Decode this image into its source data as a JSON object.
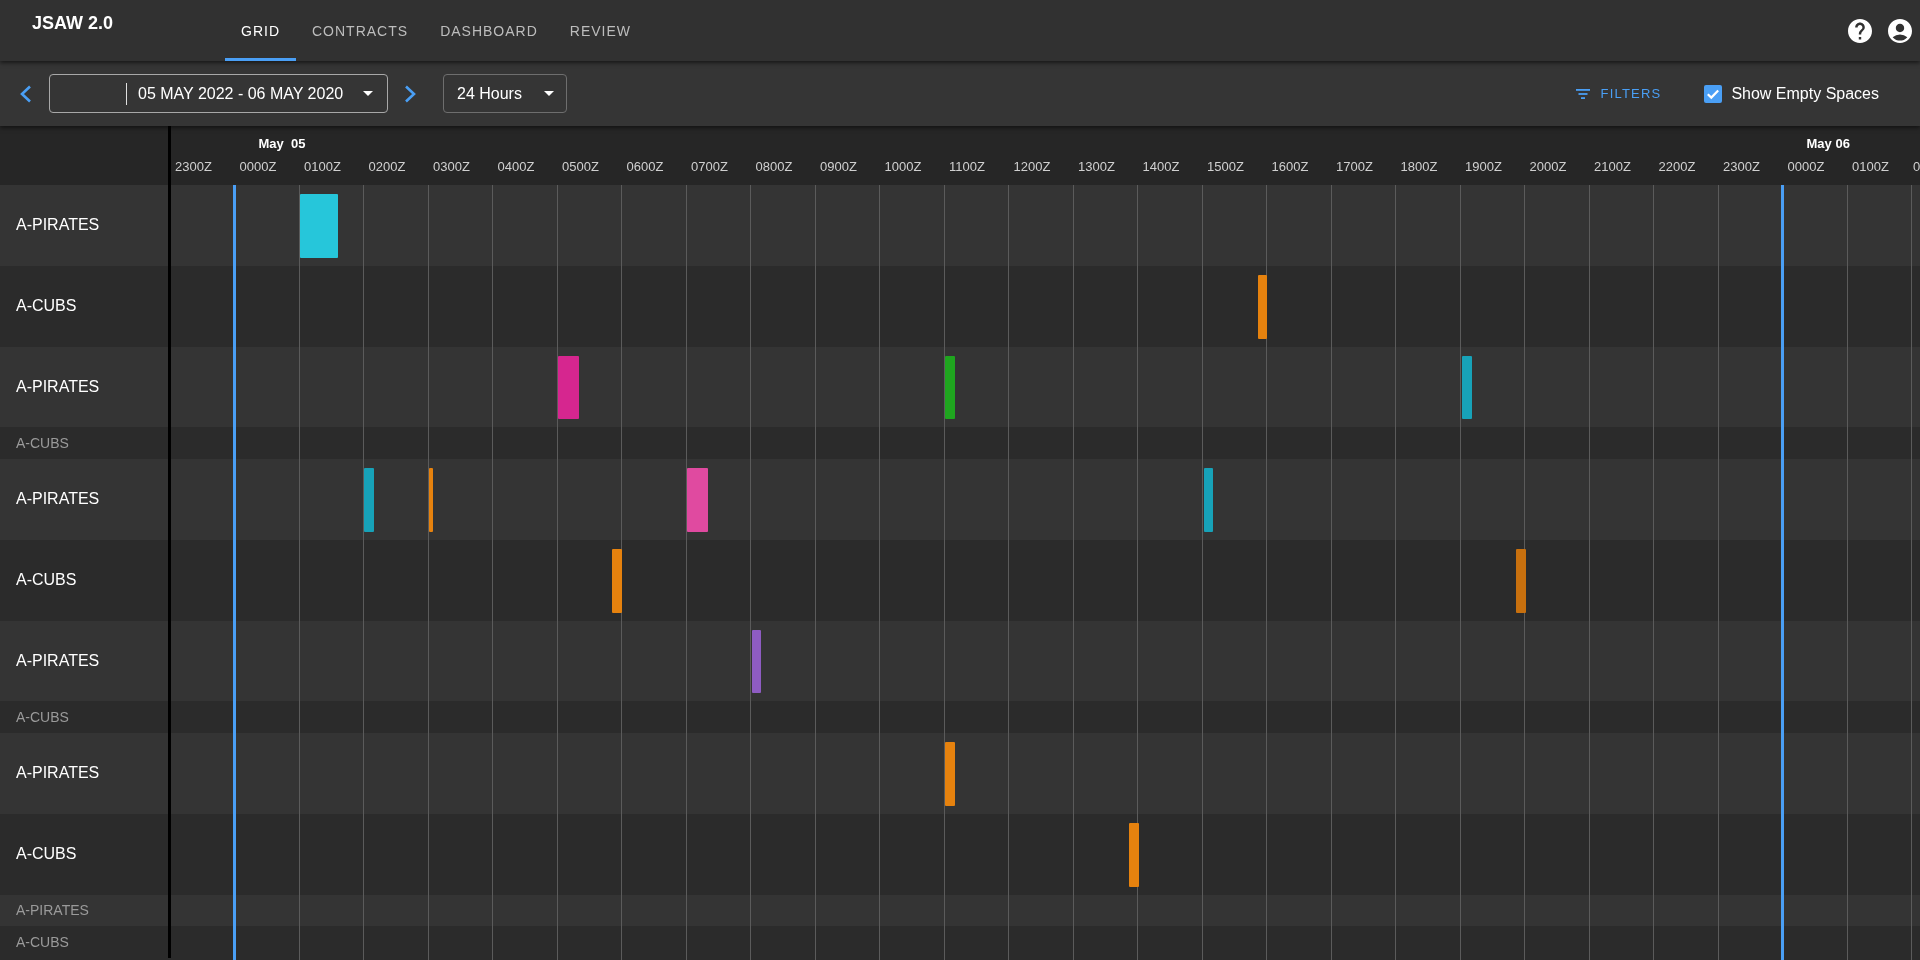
{
  "app": {
    "title": "JSAW 2.0"
  },
  "tabs": [
    {
      "label": "GRID",
      "selected": true
    },
    {
      "label": "CONTRACTS",
      "selected": false
    },
    {
      "label": "DASHBOARD",
      "selected": false
    },
    {
      "label": "REVIEW",
      "selected": false
    }
  ],
  "toolbar": {
    "date_range": {
      "value": "05 MAY 2022 - 06 MAY 2020"
    },
    "span": {
      "value": "24 Hours"
    },
    "filters": {
      "label": "FILTERS"
    },
    "show_empty": {
      "label": "Show Empty Spaces",
      "checked": true
    }
  },
  "timeline": {
    "columns": [
      {
        "label": "2300Z"
      },
      {
        "label": "0000Z",
        "date": "May  05"
      },
      {
        "label": "0100Z"
      },
      {
        "label": "0200Z"
      },
      {
        "label": "0300Z"
      },
      {
        "label": "0400Z"
      },
      {
        "label": "0500Z"
      },
      {
        "label": "0600Z"
      },
      {
        "label": "0700Z"
      },
      {
        "label": "0800Z"
      },
      {
        "label": "0900Z"
      },
      {
        "label": "1000Z"
      },
      {
        "label": "1100Z"
      },
      {
        "label": "1200Z"
      },
      {
        "label": "1300Z"
      },
      {
        "label": "1400Z"
      },
      {
        "label": "1500Z"
      },
      {
        "label": "1600Z"
      },
      {
        "label": "1700Z"
      },
      {
        "label": "1800Z"
      },
      {
        "label": "1900Z"
      },
      {
        "label": "2000Z"
      },
      {
        "label": "2100Z"
      },
      {
        "label": "2200Z"
      },
      {
        "label": "2300Z"
      },
      {
        "label": "0000Z",
        "date": "May 06"
      },
      {
        "label": "0100Z"
      },
      {
        "label": "0"
      }
    ]
  },
  "rows": [
    {
      "label": "A-PIRATES",
      "events": [
        {
          "color": "#26c6da"
        }
      ]
    },
    {
      "label": "A-CUBS",
      "events": [
        {
          "color": "#e6820e"
        }
      ]
    },
    {
      "label": "A-PIRATES",
      "events": [
        {
          "color": "#d6268f"
        },
        {
          "color": "#1fa51f"
        },
        {
          "color": "#17a2b8"
        }
      ]
    },
    {
      "label": "A-CUBS",
      "events": []
    },
    {
      "label": "A-PIRATES",
      "events": [
        {
          "color": "#17a2b8"
        },
        {
          "color": "#e6820e"
        },
        {
          "color": "#e04aa0"
        },
        {
          "color": "#17a2b8"
        }
      ]
    },
    {
      "label": "A-CUBS",
      "events": [
        {
          "color": "#e6820e"
        },
        {
          "color": "#c8700e"
        }
      ]
    },
    {
      "label": "A-PIRATES",
      "events": [
        {
          "color": "#8e5cc2"
        }
      ]
    },
    {
      "label": "A-CUBS",
      "events": []
    },
    {
      "label": "A-PIRATES",
      "events": [
        {
          "color": "#e6820e"
        }
      ]
    },
    {
      "label": "A-CUBS",
      "events": [
        {
          "color": "#e6820e"
        }
      ]
    },
    {
      "label": "A-PIRATES",
      "events": []
    },
    {
      "label": "A-CUBS",
      "events": []
    }
  ]
}
